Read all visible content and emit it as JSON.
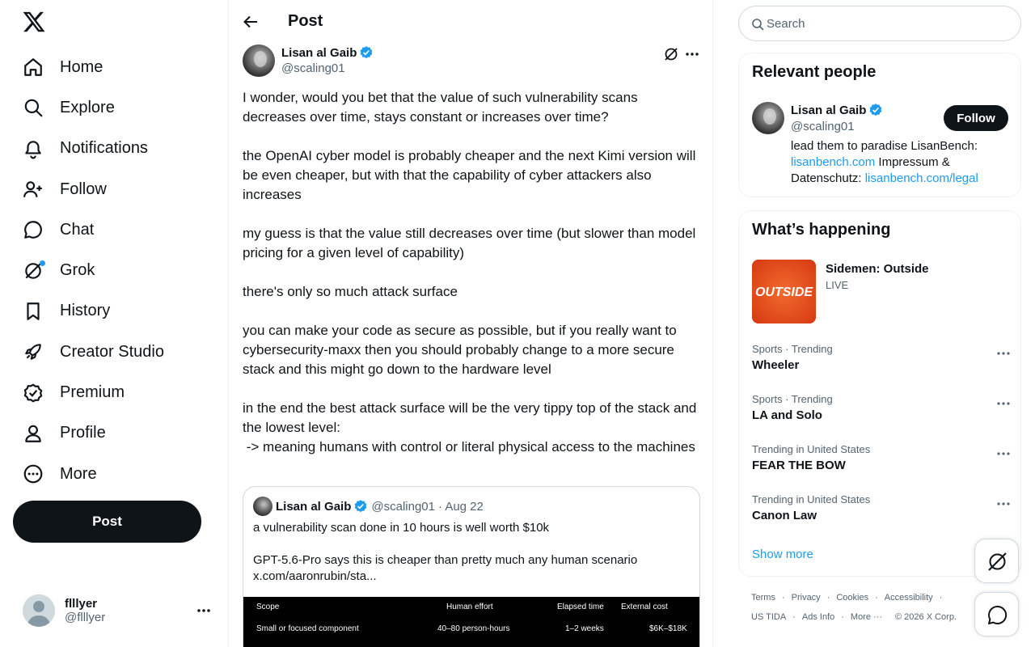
{
  "nav": {
    "items": [
      {
        "label": "Home",
        "icon": "home-icon"
      },
      {
        "label": "Explore",
        "icon": "search-icon"
      },
      {
        "label": "Notifications",
        "icon": "bell-icon"
      },
      {
        "label": "Follow",
        "icon": "person-add-icon"
      },
      {
        "label": "Chat",
        "icon": "chat-bubble-icon"
      },
      {
        "label": "Grok",
        "icon": "grok-icon"
      },
      {
        "label": "History",
        "icon": "bookmark-icon"
      },
      {
        "label": "Creator Studio",
        "icon": "rocket-icon"
      },
      {
        "label": "Premium",
        "icon": "verified-badge-icon"
      },
      {
        "label": "Profile",
        "icon": "person-icon"
      },
      {
        "label": "More",
        "icon": "more-circle-icon"
      }
    ],
    "post_label": "Post"
  },
  "account": {
    "name": "flllyer",
    "handle": "@flllyer"
  },
  "header": {
    "title": "Post"
  },
  "post": {
    "author_name": "Lisan al Gaib",
    "author_handle": "@scaling01",
    "text": "I wonder, would you bet that the value of such vulnerability scans decreases over time, stays constant or increases over time?\n\nthe OpenAI cyber model is probably cheaper and the next Kimi version will be even cheaper, but with that the capability of cyber attackers also increases\n\nmy guess is that the value still decreases over time (but slower than model pricing for a given level of capability)\n\nthere's only so much attack surface\n\nyou can make your code as secure as possible, but if you really want to cybersecurity-maxx then you should probably change to a more secure stack and this might go down to the hardware level\n\nin the end the best attack surface will be the very tippy top of the stack and the lowest level:\n -> meaning humans with control or literal physical access to the machines",
    "quote": {
      "author_name": "Lisan al Gaib",
      "author_handle": "@scaling01",
      "date": "· Aug 22",
      "text": "a vulnerability scan done in 10 hours is well worth $10k\n\nGPT-5.6-Pro says this is cheaper than pretty much any human scenario\nx.com/aaronrubin/sta...",
      "table": {
        "headers": [
          "Scope",
          "Human effort",
          "Elapsed time",
          "External cost"
        ],
        "row": [
          "Small or focused component",
          "40–80 person-hours",
          "1–2 weeks",
          "$6K–$18K"
        ]
      }
    }
  },
  "search": {
    "placeholder": "Search"
  },
  "relevant": {
    "title": "Relevant people",
    "name": "Lisan al Gaib",
    "handle": "@scaling01",
    "follow_label": "Follow",
    "bio_text1": "lead them to paradise LisanBench: ",
    "bio_link1": "lisanbench.com",
    "bio_text2": " Impressum & Datenschutz: ",
    "bio_link2": "lisanbench.com/legal"
  },
  "happening": {
    "title": "What’s happening",
    "featured": {
      "title": "Sidemen: Outside",
      "status": "LIVE",
      "thumb_text": "OUTSIDE"
    },
    "trends": [
      {
        "context": "Sports · Trending",
        "name": "Wheeler"
      },
      {
        "context": "Sports · Trending",
        "name": "LA and Solo"
      },
      {
        "context": "Trending in United States",
        "name": "FEAR THE BOW"
      },
      {
        "context": "Trending in United States",
        "name": "Canon Law"
      }
    ],
    "show_more": "Show more"
  },
  "footer": {
    "row1": [
      "Terms",
      "Privacy",
      "Cookies",
      "Accessibility"
    ],
    "row2": [
      "US TIDA",
      "Ads Info",
      "More ···",
      "© 2026 X Corp."
    ]
  },
  "colors": {
    "accent": "#1d9bf0",
    "text": "#0f1419",
    "muted": "#536471"
  }
}
